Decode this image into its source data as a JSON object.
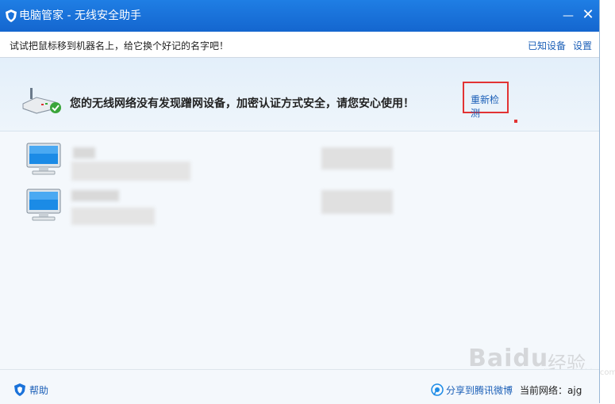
{
  "window": {
    "title": "电脑管家 - 无线安全助手",
    "minimize_glyph": "—",
    "close_glyph": "✕"
  },
  "toolbar": {
    "hint": "试试把鼠标移到机器名上，给它换个好记的名字吧！",
    "known_devices_label": "已知设备",
    "settings_label": "设置"
  },
  "banner": {
    "message": "您的无线网络没有发现蹭网设备，加密认证方式安全，请您安心使用！",
    "recheck_label": "重新检测"
  },
  "devices": [
    {
      "icon": "monitor-icon"
    },
    {
      "icon": "monitor-icon"
    }
  ],
  "footer": {
    "help_label": "帮助",
    "share_label": "分享到腾讯微博",
    "current_network_label": "当前网络：ajg"
  },
  "watermark": {
    "brand": "Baidu",
    "cn": "经验",
    "sub": "jingyan.baidu.com"
  },
  "colors": {
    "titlebar": "#1a72da",
    "link": "#1b5fb7",
    "highlight_box": "#e23333"
  }
}
